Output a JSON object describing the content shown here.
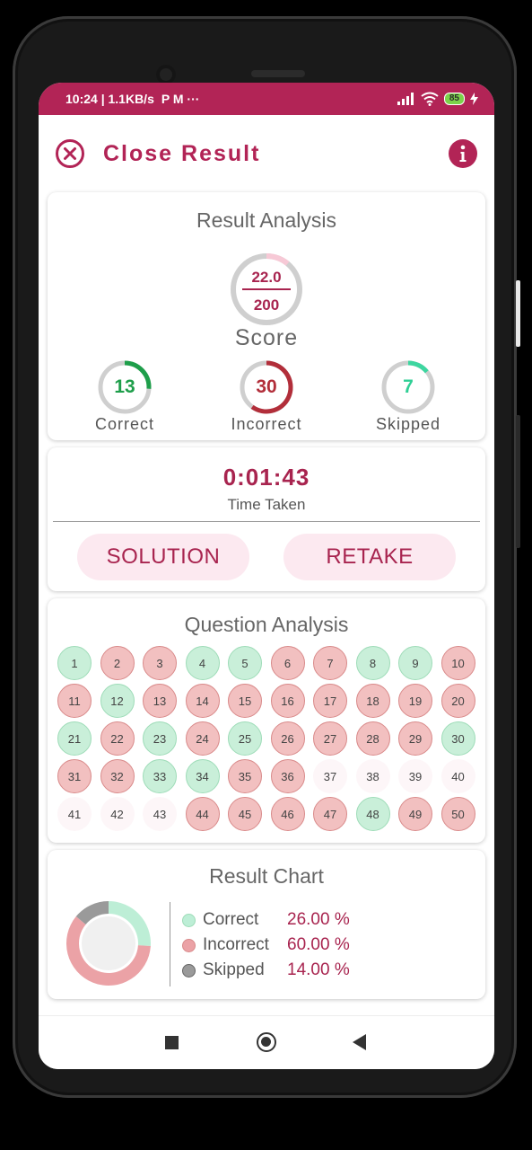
{
  "status_bar": {
    "time_speed": "10:24 | 1.1KB/s",
    "app_icons": "P M ···",
    "battery": "85"
  },
  "header": {
    "title": "Close Result"
  },
  "result_analysis": {
    "title": "Result Analysis",
    "score_obtained": "22.0",
    "score_total": "200",
    "score_fraction": 0.11,
    "score_label": "Score",
    "stats": [
      {
        "value": "13",
        "label": "Correct",
        "fraction": 0.26,
        "color": "#1e9e4a"
      },
      {
        "value": "30",
        "label": "Incorrect",
        "fraction": 0.6,
        "color": "#b22e3a"
      },
      {
        "value": "7",
        "label": "Skipped",
        "fraction": 0.14,
        "color": "#3dd6a0"
      }
    ]
  },
  "time": {
    "value": "0:01:43",
    "label": "Time Taken"
  },
  "actions": {
    "solution": "SOLUTION",
    "retake": "RETAKE"
  },
  "question_analysis": {
    "title": "Question Analysis",
    "questions": [
      {
        "n": "1",
        "s": "c"
      },
      {
        "n": "2",
        "s": "i"
      },
      {
        "n": "3",
        "s": "i"
      },
      {
        "n": "4",
        "s": "c"
      },
      {
        "n": "5",
        "s": "c"
      },
      {
        "n": "6",
        "s": "i"
      },
      {
        "n": "7",
        "s": "i"
      },
      {
        "n": "8",
        "s": "c"
      },
      {
        "n": "9",
        "s": "c"
      },
      {
        "n": "10",
        "s": "i"
      },
      {
        "n": "11",
        "s": "i"
      },
      {
        "n": "12",
        "s": "c"
      },
      {
        "n": "13",
        "s": "i"
      },
      {
        "n": "14",
        "s": "i"
      },
      {
        "n": "15",
        "s": "i"
      },
      {
        "n": "16",
        "s": "i"
      },
      {
        "n": "17",
        "s": "i"
      },
      {
        "n": "18",
        "s": "i"
      },
      {
        "n": "19",
        "s": "i"
      },
      {
        "n": "20",
        "s": "i"
      },
      {
        "n": "21",
        "s": "c"
      },
      {
        "n": "22",
        "s": "i"
      },
      {
        "n": "23",
        "s": "c"
      },
      {
        "n": "24",
        "s": "i"
      },
      {
        "n": "25",
        "s": "c"
      },
      {
        "n": "26",
        "s": "i"
      },
      {
        "n": "27",
        "s": "i"
      },
      {
        "n": "28",
        "s": "i"
      },
      {
        "n": "29",
        "s": "i"
      },
      {
        "n": "30",
        "s": "c"
      },
      {
        "n": "31",
        "s": "i"
      },
      {
        "n": "32",
        "s": "i"
      },
      {
        "n": "33",
        "s": "c"
      },
      {
        "n": "34",
        "s": "c"
      },
      {
        "n": "35",
        "s": "i"
      },
      {
        "n": "36",
        "s": "i"
      },
      {
        "n": "37",
        "s": "s"
      },
      {
        "n": "38",
        "s": "s"
      },
      {
        "n": "39",
        "s": "s"
      },
      {
        "n": "40",
        "s": "s"
      },
      {
        "n": "41",
        "s": "s"
      },
      {
        "n": "42",
        "s": "s"
      },
      {
        "n": "43",
        "s": "s"
      },
      {
        "n": "44",
        "s": "i"
      },
      {
        "n": "45",
        "s": "i"
      },
      {
        "n": "46",
        "s": "i"
      },
      {
        "n": "47",
        "s": "i"
      },
      {
        "n": "48",
        "s": "c"
      },
      {
        "n": "49",
        "s": "i"
      },
      {
        "n": "50",
        "s": "i"
      }
    ]
  },
  "result_chart": {
    "title": "Result Chart",
    "legend": [
      {
        "name": "Correct",
        "value": "26.00 %",
        "color": "#bdeed6"
      },
      {
        "name": "Incorrect",
        "value": "60.00 %",
        "color": "#eba2a6"
      },
      {
        "name": "Skipped",
        "value": "14.00 %",
        "color": "#9a9a9a"
      }
    ]
  },
  "chart_data": {
    "type": "pie",
    "categories": [
      "Correct",
      "Incorrect",
      "Skipped"
    ],
    "values": [
      26.0,
      60.0,
      14.0
    ],
    "title": "Result Chart"
  }
}
